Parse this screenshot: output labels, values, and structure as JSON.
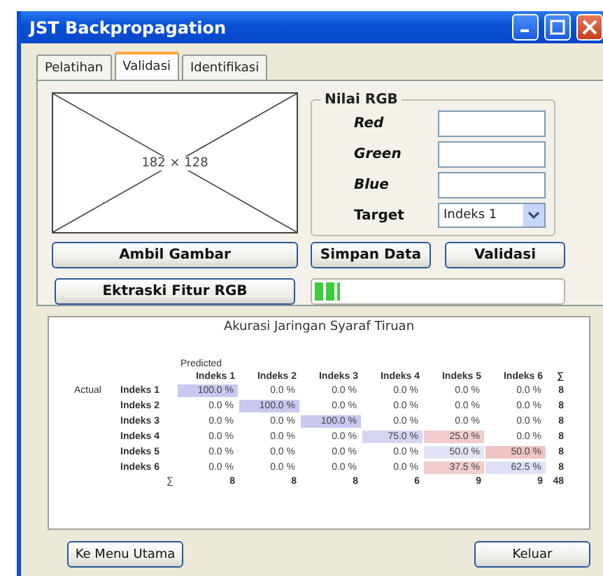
{
  "window": {
    "title": "JST Backpropagation"
  },
  "tabs": [
    {
      "label": "Pelatihan",
      "selected": false
    },
    {
      "label": "Validasi",
      "selected": true
    },
    {
      "label": "Identifikasi",
      "selected": false
    }
  ],
  "image_placeholder": {
    "text": "182 × 128"
  },
  "rgb_group": {
    "title": "Nilai RGB",
    "fields": [
      {
        "label": "Red"
      },
      {
        "label": "Green"
      },
      {
        "label": "Blue"
      }
    ],
    "target": {
      "label": "Target",
      "value": "Indeks 1"
    }
  },
  "buttons": {
    "ambil": "Ambil Gambar",
    "simpan": "Simpan Data",
    "validasi": "Validasi",
    "ektraski": "Ektraski Fitur RGB"
  },
  "progress": {
    "level": 0.1
  },
  "matrix": {
    "title": "Akurasi Jaringan Syaraf Tiruan",
    "predicted_label": "Predicted",
    "actual_label": "Actual",
    "columns": [
      "Indeks 1",
      "Indeks 2",
      "Indeks 3",
      "Indeks 4",
      "Indeks 5",
      "Indeks 6",
      "∑"
    ],
    "rows": [
      {
        "label": "Indeks 1",
        "cells": [
          {
            "text": "100.0 %",
            "color": "#c8c8f0"
          },
          {
            "text": "0.0 %"
          },
          {
            "text": "0.0 %"
          },
          {
            "text": "0.0 %"
          },
          {
            "text": "0.0 %"
          },
          {
            "text": "0.0 %"
          }
        ],
        "total": "8"
      },
      {
        "label": "Indeks 2",
        "cells": [
          {
            "text": "0.0 %"
          },
          {
            "text": "100.0 %",
            "color": "#c8c8f0"
          },
          {
            "text": "0.0 %"
          },
          {
            "text": "0.0 %"
          },
          {
            "text": "0.0 %"
          },
          {
            "text": "0.0 %"
          }
        ],
        "total": "8"
      },
      {
        "label": "Indeks 3",
        "cells": [
          {
            "text": "0.0 %"
          },
          {
            "text": "0.0 %"
          },
          {
            "text": "100.0 %",
            "color": "#c8c8f0"
          },
          {
            "text": "0.0 %"
          },
          {
            "text": "0.0 %"
          },
          {
            "text": "0.0 %"
          }
        ],
        "total": "8"
      },
      {
        "label": "Indeks 4",
        "cells": [
          {
            "text": "0.0 %"
          },
          {
            "text": "0.0 %"
          },
          {
            "text": "0.0 %"
          },
          {
            "text": "75.0 %",
            "color": "#d6d6f4"
          },
          {
            "text": "25.0 %",
            "color": "#f2cccc"
          },
          {
            "text": "0.0 %"
          }
        ],
        "total": "8"
      },
      {
        "label": "Indeks 5",
        "cells": [
          {
            "text": "0.0 %"
          },
          {
            "text": "0.0 %"
          },
          {
            "text": "0.0 %"
          },
          {
            "text": "0.0 %"
          },
          {
            "text": "50.0 %",
            "color": "#e4e4f8"
          },
          {
            "text": "50.0 %",
            "color": "#f0c4c4"
          }
        ],
        "total": "8"
      },
      {
        "label": "Indeks 6",
        "cells": [
          {
            "text": "0.0 %"
          },
          {
            "text": "0.0 %"
          },
          {
            "text": "0.0 %"
          },
          {
            "text": "0.0 %"
          },
          {
            "text": "37.5 %",
            "color": "#f2cccc"
          },
          {
            "text": "62.5 %",
            "color": "#e0e0f6"
          }
        ],
        "total": "8"
      }
    ],
    "totals": {
      "label": "∑",
      "values": [
        "8",
        "8",
        "8",
        "6",
        "9",
        "9"
      ],
      "grand": "48"
    }
  },
  "footer": {
    "back": "Ke Menu Utama",
    "exit": "Keluar"
  }
}
